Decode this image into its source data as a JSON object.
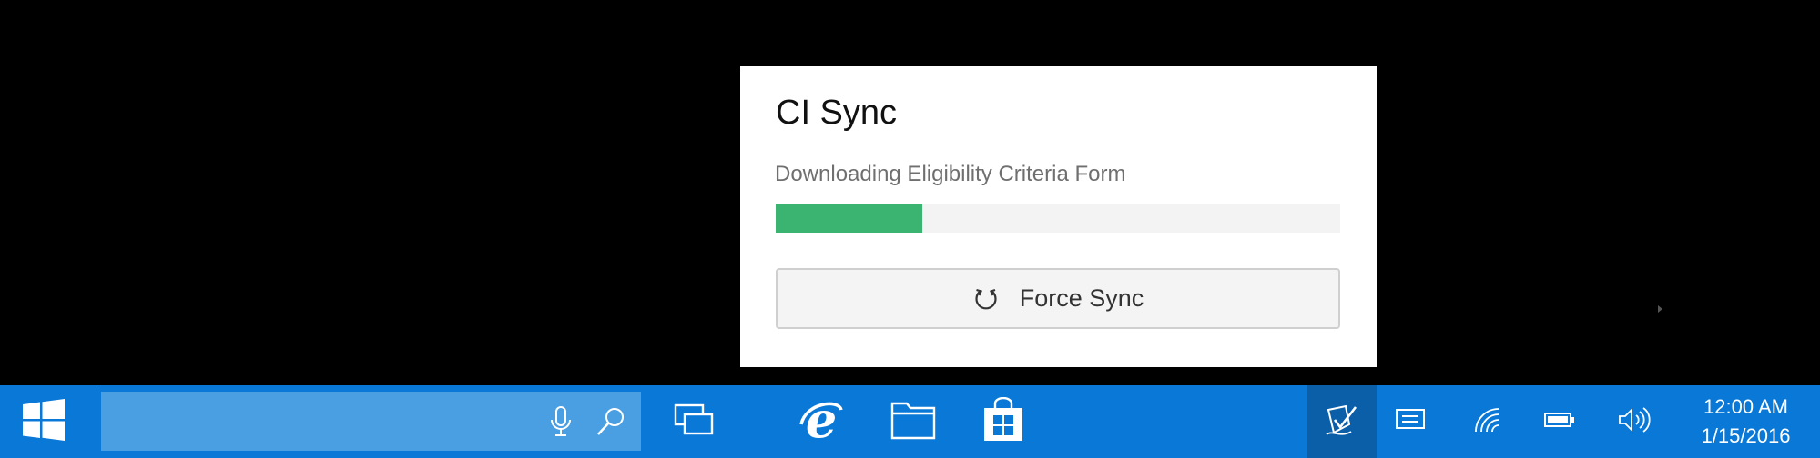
{
  "flyout": {
    "title": "CI Sync",
    "status": "Downloading Eligibility Criteria Form",
    "progress_fraction": 0.26,
    "progress_color": "#3bb371",
    "button_label": "Force Sync",
    "button_icon": "refresh-icon"
  },
  "taskbar": {
    "background_color": "#0a78d7",
    "start_icon": "windows-logo-icon",
    "search": {
      "placeholder": "",
      "mic_icon": "microphone-icon",
      "search_icon": "search-icon"
    },
    "task_view_icon": "task-view-icon",
    "pinned": [
      {
        "name": "edge",
        "icon": "internet-explorer-icon"
      },
      {
        "name": "file-explorer",
        "icon": "folder-icon"
      },
      {
        "name": "store",
        "icon": "store-bag-icon"
      }
    ],
    "tray": [
      {
        "name": "ci-sync",
        "icon": "signature-check-icon",
        "active": true
      },
      {
        "name": "notifications",
        "icon": "message-icon"
      },
      {
        "name": "wifi",
        "icon": "wifi-icon"
      },
      {
        "name": "battery",
        "icon": "battery-icon"
      },
      {
        "name": "volume",
        "icon": "speaker-icon"
      }
    ],
    "clock": {
      "time": "12:00 AM",
      "date": "1/15/2016"
    }
  }
}
